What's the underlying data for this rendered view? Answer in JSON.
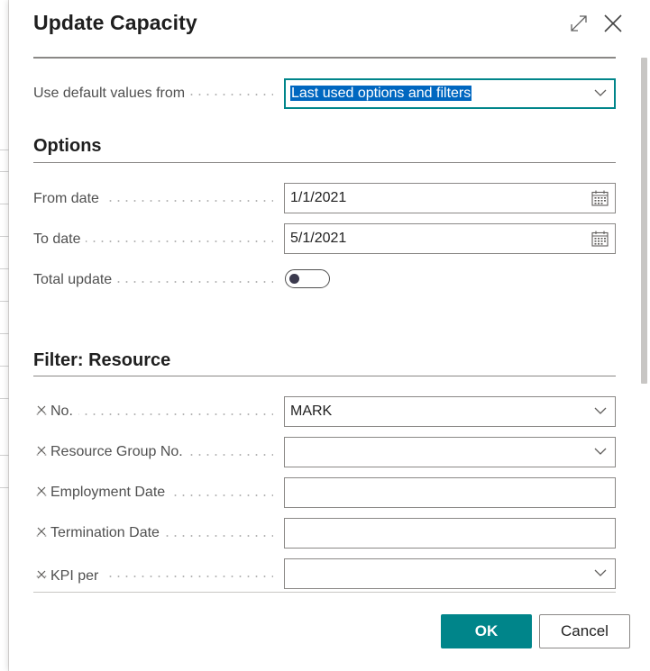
{
  "dialog": {
    "title": "Update Capacity"
  },
  "defaults": {
    "label": "Use default values from",
    "value": "Last used options and filters"
  },
  "options": {
    "title": "Options",
    "from_date": {
      "label": "From date",
      "value": "1/1/2021"
    },
    "to_date": {
      "label": "To date",
      "value": "5/1/2021"
    },
    "total_update": {
      "label": "Total update",
      "on": false
    }
  },
  "filter": {
    "title": "Filter: Resource",
    "fields": [
      {
        "label": "No.",
        "value": "MARK",
        "kind": "dropdown"
      },
      {
        "label": "Resource Group No.",
        "value": "",
        "kind": "dropdown"
      },
      {
        "label": "Employment Date",
        "value": "",
        "kind": "text"
      },
      {
        "label": "Termination Date",
        "value": "",
        "kind": "text"
      },
      {
        "label": "KPI per",
        "value": "",
        "kind": "dropdown"
      }
    ]
  },
  "footer": {
    "ok_label": "OK",
    "cancel_label": "Cancel"
  },
  "colors": {
    "accent": "#00858a",
    "selection": "#0067c0"
  }
}
